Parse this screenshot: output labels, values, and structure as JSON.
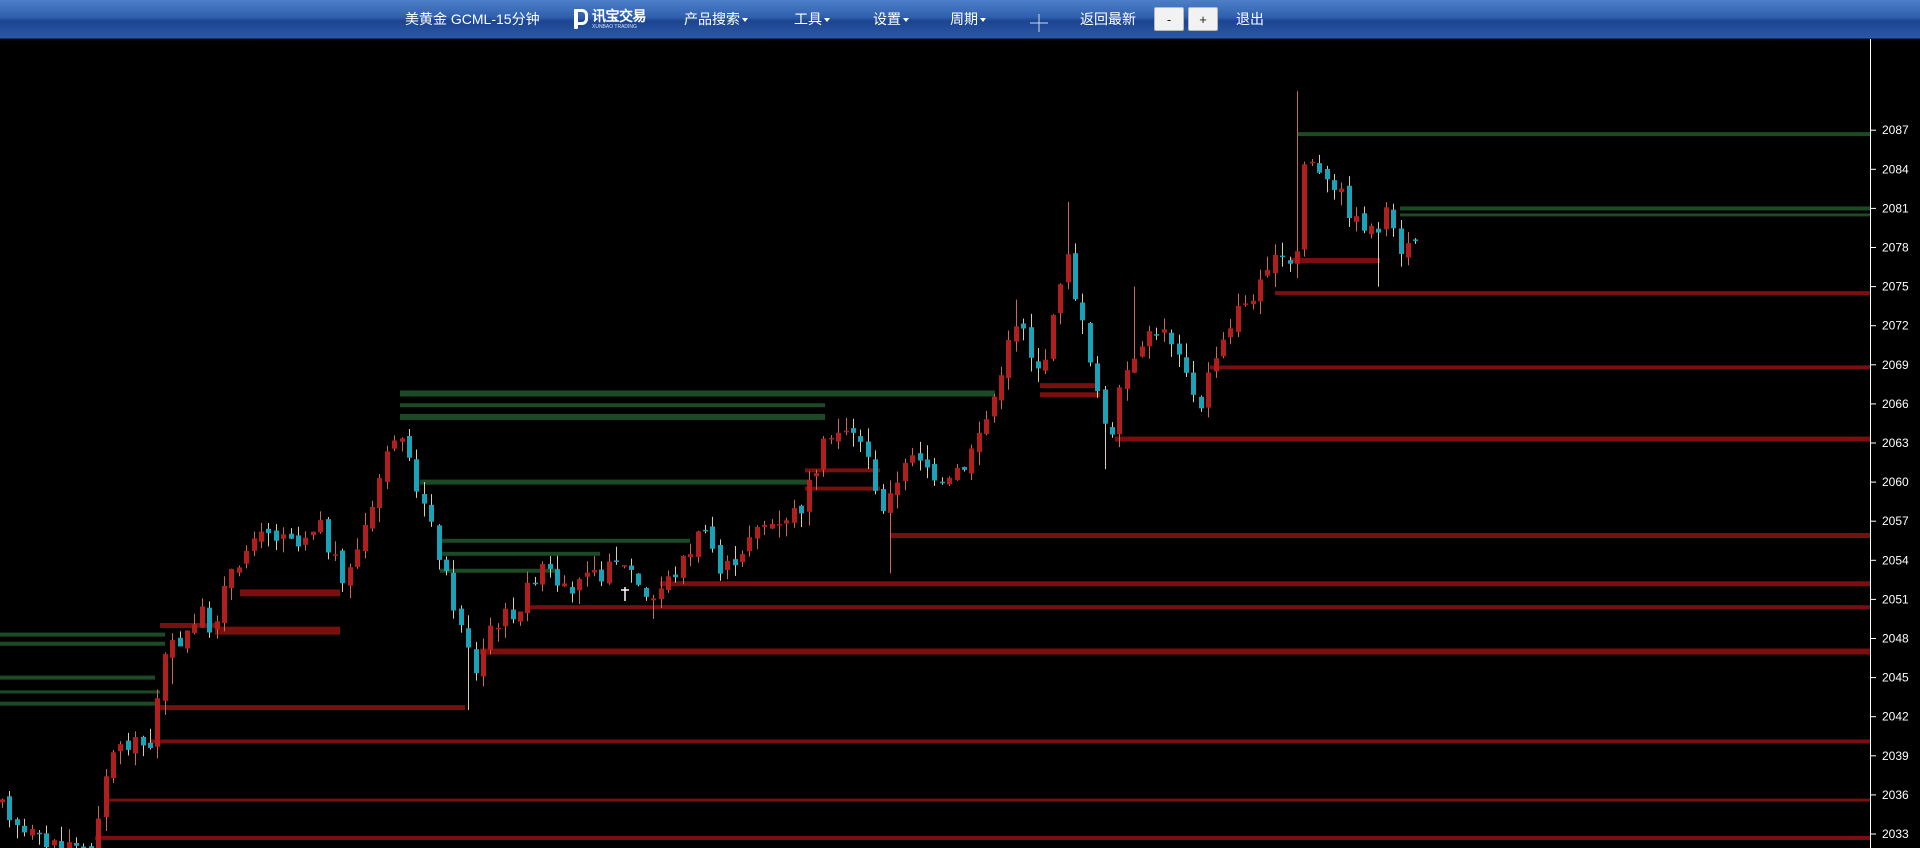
{
  "toolbar": {
    "title": "美黄金 GCML-15分钟",
    "logo_text": "讯宝交易",
    "logo_subtext": "XUNBAO TRADING",
    "menu_search": "产品搜索",
    "menu_tools": "工具",
    "menu_settings": "设置",
    "menu_period": "周期",
    "crosshair_icon": "crosshair-icon",
    "back_latest": "返回最新",
    "zoom_out": "-",
    "zoom_in": "+",
    "logout": "退出"
  },
  "colors": {
    "background": "#000000",
    "up_candle": "#b01e1e",
    "down_candle": "#1aa3b8",
    "support_zone": "#1d4a26",
    "resistance_zone": "#7a0f0f",
    "toolbar": "#2a58a6"
  },
  "chart_data": {
    "type": "candlestick",
    "symbol": "美黄金 GCML",
    "period": "15分钟",
    "ylim": [
      2031,
      2091
    ],
    "y_ticks": [
      2033,
      2036,
      2039,
      2042,
      2045,
      2048,
      2051,
      2054,
      2057,
      2060,
      2063,
      2066,
      2069,
      2072,
      2075,
      2078,
      2081,
      2084,
      2087
    ],
    "anchors": [
      {
        "x": 0,
        "p": 2035.2
      },
      {
        "x": 40,
        "p": 2032.5
      },
      {
        "x": 95,
        "p": 2032.0
      },
      {
        "x": 110,
        "p": 2039.5
      },
      {
        "x": 150,
        "p": 2040.0
      },
      {
        "x": 165,
        "p": 2046.5
      },
      {
        "x": 200,
        "p": 2050.0
      },
      {
        "x": 215,
        "p": 2048.5
      },
      {
        "x": 230,
        "p": 2053.5
      },
      {
        "x": 265,
        "p": 2056.0
      },
      {
        "x": 300,
        "p": 2055.0
      },
      {
        "x": 320,
        "p": 2056.5
      },
      {
        "x": 345,
        "p": 2052.0
      },
      {
        "x": 365,
        "p": 2057.0
      },
      {
        "x": 395,
        "p": 2064.0
      },
      {
        "x": 405,
        "p": 2062.0
      },
      {
        "x": 425,
        "p": 2058.0
      },
      {
        "x": 460,
        "p": 2049.0
      },
      {
        "x": 475,
        "p": 2045.5
      },
      {
        "x": 490,
        "p": 2049.0
      },
      {
        "x": 520,
        "p": 2050.5
      },
      {
        "x": 545,
        "p": 2054.5
      },
      {
        "x": 565,
        "p": 2051.5
      },
      {
        "x": 600,
        "p": 2053.0
      },
      {
        "x": 625,
        "p": 2054.0
      },
      {
        "x": 650,
        "p": 2051.0
      },
      {
        "x": 680,
        "p": 2053.5
      },
      {
        "x": 705,
        "p": 2057.0
      },
      {
        "x": 720,
        "p": 2053.0
      },
      {
        "x": 760,
        "p": 2056.5
      },
      {
        "x": 800,
        "p": 2058.0
      },
      {
        "x": 830,
        "p": 2064.0
      },
      {
        "x": 860,
        "p": 2063.5
      },
      {
        "x": 885,
        "p": 2057.5
      },
      {
        "x": 905,
        "p": 2062.0
      },
      {
        "x": 940,
        "p": 2060.5
      },
      {
        "x": 965,
        "p": 2061.5
      },
      {
        "x": 990,
        "p": 2065.5
      },
      {
        "x": 1005,
        "p": 2070.0
      },
      {
        "x": 1020,
        "p": 2072.5
      },
      {
        "x": 1035,
        "p": 2068.0
      },
      {
        "x": 1050,
        "p": 2071.0
      },
      {
        "x": 1065,
        "p": 2078.0
      },
      {
        "x": 1080,
        "p": 2073.0
      },
      {
        "x": 1095,
        "p": 2067.0
      },
      {
        "x": 1110,
        "p": 2063.5
      },
      {
        "x": 1125,
        "p": 2068.5
      },
      {
        "x": 1140,
        "p": 2071.0
      },
      {
        "x": 1160,
        "p": 2072.0
      },
      {
        "x": 1180,
        "p": 2069.0
      },
      {
        "x": 1200,
        "p": 2066.0
      },
      {
        "x": 1215,
        "p": 2070.0
      },
      {
        "x": 1240,
        "p": 2073.5
      },
      {
        "x": 1260,
        "p": 2075.0
      },
      {
        "x": 1285,
        "p": 2078.0
      },
      {
        "x": 1295,
        "p": 2076.0
      },
      {
        "x": 1305,
        "p": 2085.0
      },
      {
        "x": 1330,
        "p": 2083.5
      },
      {
        "x": 1355,
        "p": 2080.0
      },
      {
        "x": 1375,
        "p": 2079.0
      },
      {
        "x": 1390,
        "p": 2081.0
      },
      {
        "x": 1400,
        "p": 2078.0
      },
      {
        "x": 1418,
        "p": 2078.5
      }
    ],
    "spikes": [
      {
        "x": 390,
        "h": 2070.0
      },
      {
        "x": 1067,
        "h": 2081.5
      },
      {
        "x": 1297,
        "h": 2090.0
      },
      {
        "x": 1013,
        "h": 2074.0
      },
      {
        "x": 1135,
        "h": 2075.0
      },
      {
        "x": 468,
        "l": 2042.5
      },
      {
        "x": 890,
        "l": 2053.0
      },
      {
        "x": 1104,
        "l": 2061.0
      },
      {
        "x": 1378,
        "l": 2075.0
      },
      {
        "x": 170,
        "l": 2044.5
      },
      {
        "x": 655,
        "l": 2049.5
      }
    ],
    "levels": [
      {
        "kind": "support",
        "p": 2066.8,
        "x1": 400,
        "x2": 995,
        "t": 6
      },
      {
        "kind": "support",
        "p": 2065.9,
        "x1": 400,
        "x2": 825,
        "t": 4
      },
      {
        "kind": "support",
        "p": 2065.0,
        "x1": 400,
        "x2": 825,
        "t": 6
      },
      {
        "kind": "support",
        "p": 2060.0,
        "x1": 420,
        "x2": 810,
        "t": 5
      },
      {
        "kind": "support",
        "p": 2055.5,
        "x1": 440,
        "x2": 690,
        "t": 4
      },
      {
        "kind": "support",
        "p": 2054.5,
        "x1": 440,
        "x2": 600,
        "t": 4
      },
      {
        "kind": "support",
        "p": 2053.2,
        "x1": 440,
        "x2": 560,
        "t": 4
      },
      {
        "kind": "support",
        "p": 2048.3,
        "x1": 0,
        "x2": 165,
        "t": 4
      },
      {
        "kind": "support",
        "p": 2047.6,
        "x1": 0,
        "x2": 165,
        "t": 4
      },
      {
        "kind": "support",
        "p": 2045.0,
        "x1": 0,
        "x2": 155,
        "t": 4
      },
      {
        "kind": "support",
        "p": 2043.9,
        "x1": 0,
        "x2": 160,
        "t": 3
      },
      {
        "kind": "support",
        "p": 2043.0,
        "x1": 0,
        "x2": 155,
        "t": 4
      },
      {
        "kind": "support",
        "p": 2086.7,
        "x1": 1298,
        "x2": 1870,
        "t": 4
      },
      {
        "kind": "support",
        "p": 2081.0,
        "x1": 1400,
        "x2": 1870,
        "t": 4
      },
      {
        "kind": "support",
        "p": 2080.5,
        "x1": 1400,
        "x2": 1870,
        "t": 3
      },
      {
        "kind": "resistance",
        "p": 2074.5,
        "x1": 1275,
        "x2": 1870,
        "t": 4
      },
      {
        "kind": "resistance",
        "p": 2068.8,
        "x1": 1210,
        "x2": 1870,
        "t": 4
      },
      {
        "kind": "resistance",
        "p": 2063.3,
        "x1": 1115,
        "x2": 1870,
        "t": 5
      },
      {
        "kind": "resistance",
        "p": 2055.9,
        "x1": 890,
        "x2": 1870,
        "t": 5
      },
      {
        "kind": "resistance",
        "p": 2052.2,
        "x1": 660,
        "x2": 1870,
        "t": 5
      },
      {
        "kind": "resistance",
        "p": 2050.4,
        "x1": 525,
        "x2": 1870,
        "t": 4
      },
      {
        "kind": "resistance",
        "p": 2047.0,
        "x1": 480,
        "x2": 1870,
        "t": 6
      },
      {
        "kind": "resistance",
        "p": 2042.7,
        "x1": 155,
        "x2": 465,
        "t": 5
      },
      {
        "kind": "resistance",
        "p": 2040.1,
        "x1": 150,
        "x2": 1870,
        "t": 4
      },
      {
        "kind": "resistance",
        "p": 2035.6,
        "x1": 105,
        "x2": 1870,
        "t": 3
      },
      {
        "kind": "resistance",
        "p": 2032.7,
        "x1": 95,
        "x2": 1870,
        "t": 4
      },
      {
        "kind": "resistance",
        "p": 2051.5,
        "x1": 240,
        "x2": 340,
        "t": 7
      },
      {
        "kind": "resistance",
        "p": 2048.6,
        "x1": 215,
        "x2": 340,
        "t": 8
      },
      {
        "kind": "resistance",
        "p": 2049.0,
        "x1": 160,
        "x2": 215,
        "t": 5
      },
      {
        "kind": "resistance",
        "p": 2060.9,
        "x1": 805,
        "x2": 880,
        "t": 4
      },
      {
        "kind": "resistance",
        "p": 2059.5,
        "x1": 805,
        "x2": 880,
        "t": 4
      },
      {
        "kind": "resistance",
        "p": 2067.4,
        "x1": 1040,
        "x2": 1100,
        "t": 5
      },
      {
        "kind": "resistance",
        "p": 2066.7,
        "x1": 1040,
        "x2": 1100,
        "t": 5
      },
      {
        "kind": "resistance",
        "p": 2077.0,
        "x1": 1290,
        "x2": 1380,
        "t": 5
      }
    ]
  }
}
